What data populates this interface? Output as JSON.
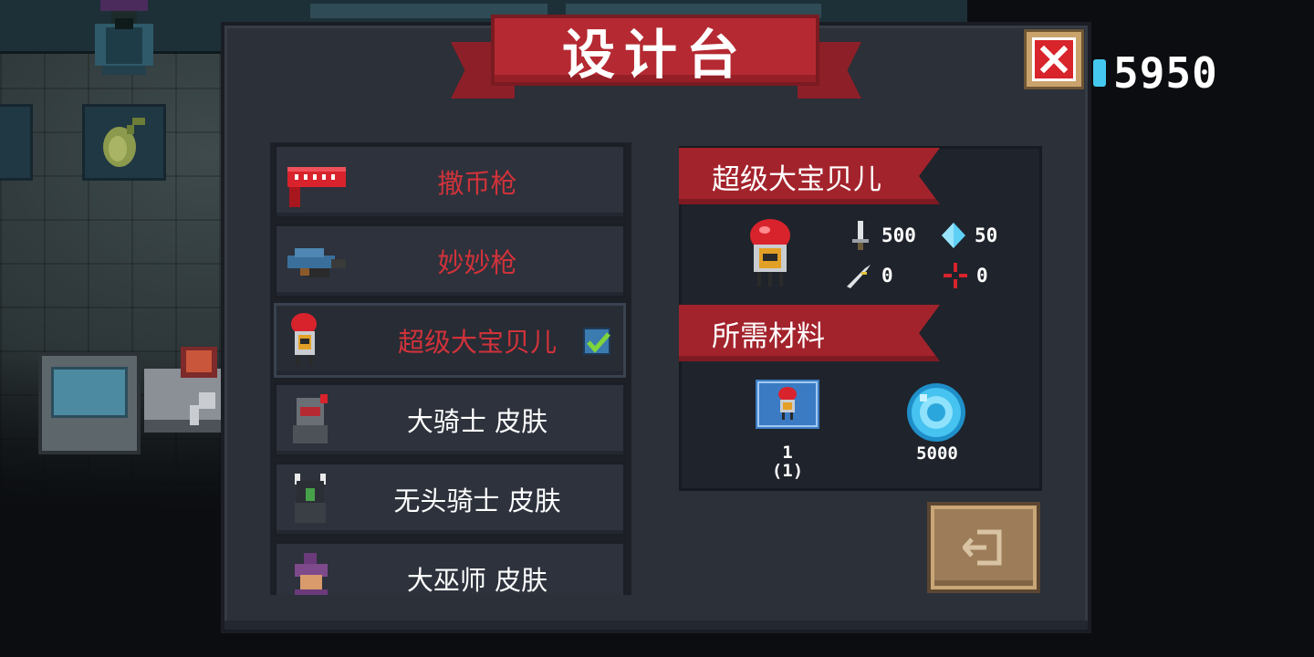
{
  "hud": {
    "coins": "5950",
    "coin_icon": "gem-icon"
  },
  "dialog": {
    "title": "设计台",
    "close_icon": "close-icon"
  },
  "blueprints": [
    {
      "name": "撒币枪",
      "icon": "red-coin-gun-icon",
      "unlocked": false,
      "selected": false
    },
    {
      "name": "妙妙枪",
      "icon": "blue-gun-icon",
      "unlocked": false,
      "selected": false
    },
    {
      "name": "超级大宝贝儿",
      "icon": "red-bomb-robot-icon",
      "unlocked": false,
      "selected": true
    },
    {
      "name": "大骑士 皮肤",
      "icon": "knight-skin-icon",
      "unlocked": true,
      "selected": false
    },
    {
      "name": "无头骑士 皮肤",
      "icon": "headless-knight-skin-icon",
      "unlocked": true,
      "selected": false
    },
    {
      "name": "大巫师 皮肤",
      "icon": "wizard-skin-icon",
      "unlocked": true,
      "selected": false
    }
  ],
  "detail": {
    "name": "超级大宝贝儿",
    "stats": {
      "attack": "500",
      "energy": "50",
      "crit": "0",
      "accuracy": "0"
    },
    "materials_heading": "所需材料",
    "materials": [
      {
        "icon": "blueprint-icon",
        "count_line1": "1",
        "count_line2": "(1)"
      },
      {
        "icon": "blue-gem-icon",
        "count_line1": "5000"
      }
    ]
  },
  "exit": {
    "icon": "exit-icon"
  },
  "colors": {
    "panel": "#2b3039",
    "ribbon_red": "#a3232c",
    "locked_text": "#d0323a",
    "gold_button": "#9d7d59"
  }
}
